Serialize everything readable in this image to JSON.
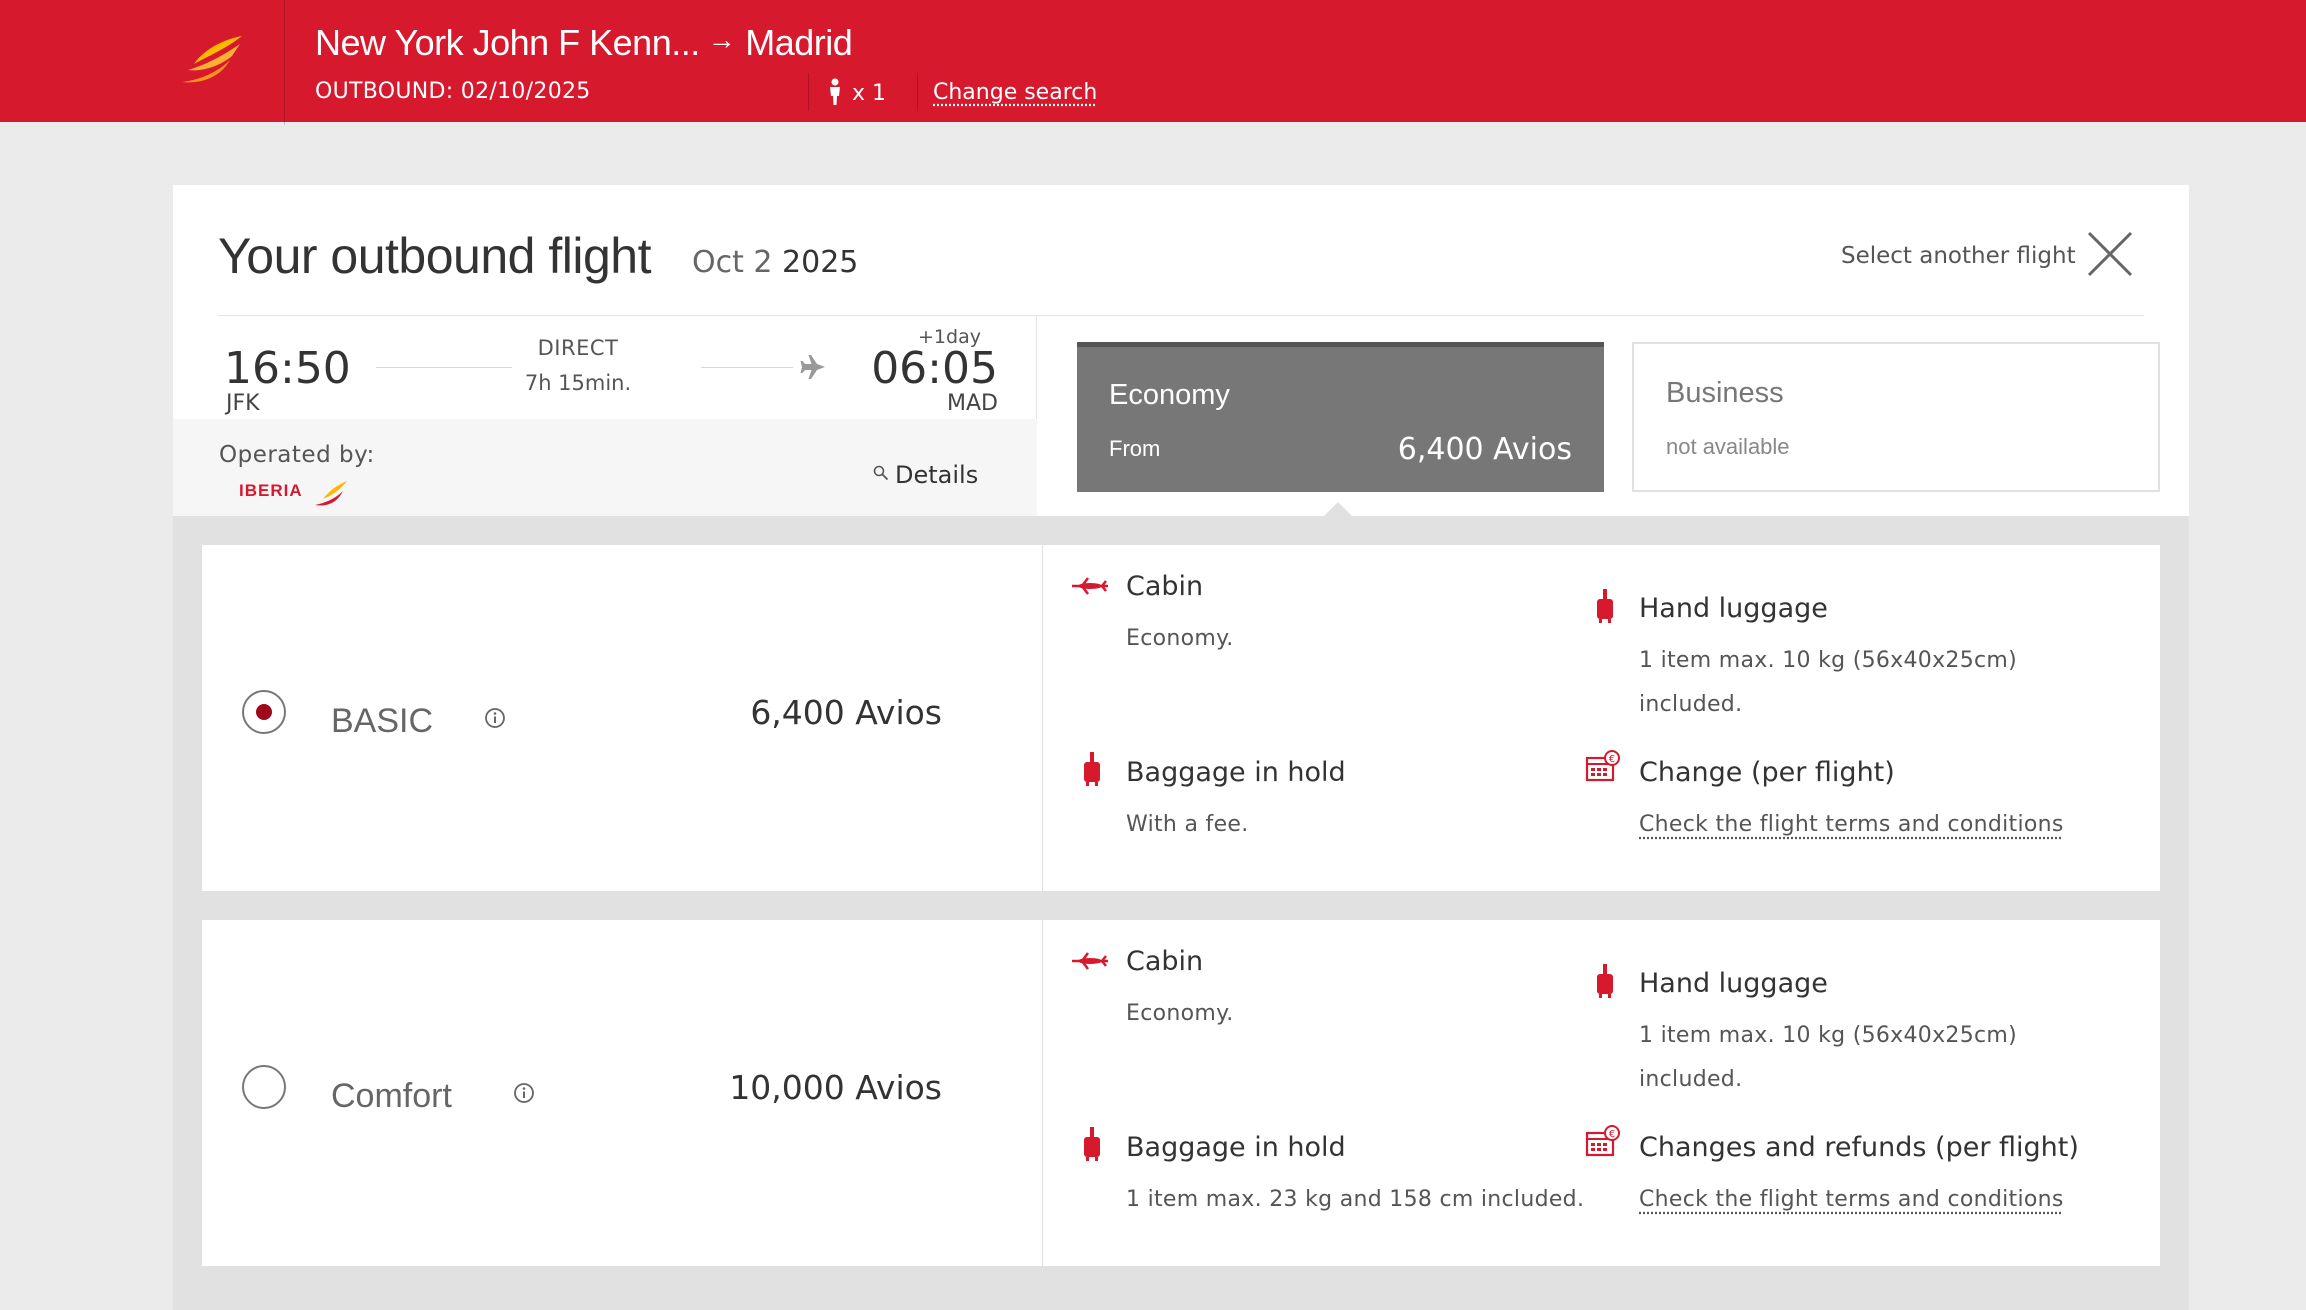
{
  "header": {
    "origin": "New York John F Kenn...",
    "arrow": "→",
    "destination": "Madrid",
    "outbound": "OUTBOUND: 02/10/2025",
    "passengers": "x 1",
    "change_search": "Change search"
  },
  "card": {
    "title": "Your outbound flight",
    "date_day": "Oct 2",
    "date_year": "2025",
    "select_another": "Select another flight"
  },
  "flight": {
    "dep_time": "16:50",
    "dep_code": "JFK",
    "type": "DIRECT",
    "duration": "7h 15min.",
    "plus_day": "+1day",
    "arr_time": "06:05",
    "arr_code": "MAD",
    "operated_by": "Operated by:",
    "airline": "IBERIA",
    "details": "Details"
  },
  "cabins": [
    {
      "name": "Economy",
      "from": "From",
      "price": "6,400 Avios",
      "selected": true
    },
    {
      "name": "Business",
      "status": "not available",
      "selected": false
    }
  ],
  "fares": [
    {
      "name": "BASIC",
      "price": "6,400 Avios",
      "selected": true,
      "features": {
        "cabin": {
          "title": "Cabin",
          "desc": "Economy."
        },
        "hand": {
          "title": "Hand luggage",
          "desc1": "1 item max. 10 kg (56x40x25cm)",
          "desc2": "included."
        },
        "hold": {
          "title": "Baggage in hold",
          "desc": "With a fee."
        },
        "change": {
          "title": "Change (per flight)",
          "desc": "Check the flight terms and conditions"
        }
      }
    },
    {
      "name": "Comfort",
      "price": "10,000 Avios",
      "selected": false,
      "features": {
        "cabin": {
          "title": "Cabin",
          "desc": "Economy."
        },
        "hand": {
          "title": "Hand luggage",
          "desc1": "1 item max. 10 kg (56x40x25cm)",
          "desc2": "included."
        },
        "hold": {
          "title": "Baggage in hold",
          "desc": "1 item max. 23 kg and 158 cm included."
        },
        "change": {
          "title": "Changes and refunds (per flight)",
          "desc": "Check the flight terms and conditions"
        }
      }
    }
  ],
  "colors": {
    "brand_red": "#d7192d",
    "icon_red": "#d7192d",
    "selected_tab": "#777777"
  },
  "icons": [
    "iberia-logo-icon",
    "passenger-icon",
    "close-icon",
    "plane-icon",
    "search-icon",
    "info-icon",
    "plane-cabin-icon",
    "suitcase-icon",
    "calendar-euro-icon"
  ]
}
